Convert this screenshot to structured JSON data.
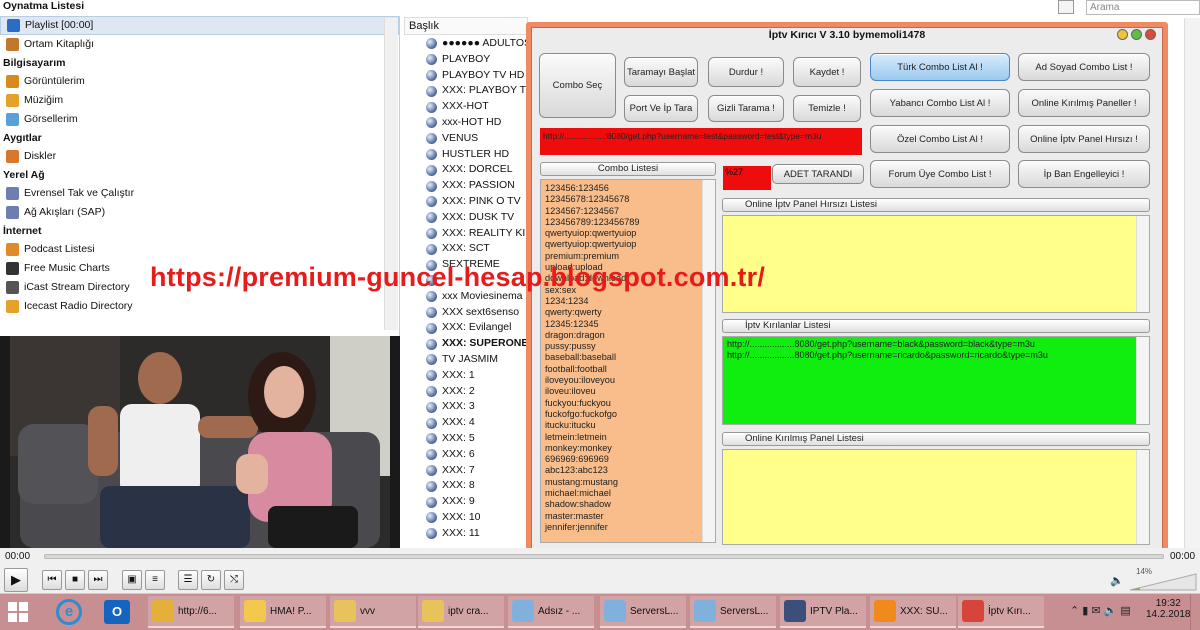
{
  "sidebar": {
    "title": "Oynatma Listesi",
    "items": [
      {
        "type": "item",
        "label": "Playlist [00:00]",
        "icon": "playlist-icon",
        "color": "#2b6cc4",
        "selected": true
      },
      {
        "type": "item",
        "label": "Ortam Kitaplığı",
        "icon": "library-icon",
        "color": "#c2772c"
      },
      {
        "type": "section",
        "label": "Bilgisayarım"
      },
      {
        "type": "item",
        "label": "Görüntülerim",
        "icon": "film-icon",
        "color": "#d88b1d"
      },
      {
        "type": "item",
        "label": "Müziğim",
        "icon": "music-icon",
        "color": "#e6a12b"
      },
      {
        "type": "item",
        "label": "Görsellerim",
        "icon": "pictures-icon",
        "color": "#5aa0d8"
      },
      {
        "type": "section",
        "label": "Aygıtlar"
      },
      {
        "type": "item",
        "label": "Diskler",
        "icon": "disc-icon",
        "color": "#d9772c"
      },
      {
        "type": "section",
        "label": "Yerel Ağ"
      },
      {
        "type": "item",
        "label": "Evrensel Tak ve Çalıştır",
        "icon": "network-icon",
        "color": "#6c7fb0"
      },
      {
        "type": "item",
        "label": "Ağ Akışları (SAP)",
        "icon": "network-icon",
        "color": "#6c7fb0"
      },
      {
        "type": "section",
        "label": "İnternet"
      },
      {
        "type": "item",
        "label": "Podcast Listesi",
        "icon": "podcast-icon",
        "color": "#e08a2a"
      },
      {
        "type": "item",
        "label": "Free Music Charts",
        "icon": "music-charts-icon",
        "color": "#333333"
      },
      {
        "type": "item",
        "label": "iCast Stream Directory",
        "icon": "icast-icon",
        "color": "#555555"
      },
      {
        "type": "item",
        "label": "Icecast Radio Directory",
        "icon": "radio-icon",
        "color": "#e6a12b"
      }
    ]
  },
  "playlist": {
    "header": "Başlık",
    "rows": [
      "●●●●●● ADULTOS",
      "PLAYBOY",
      "PLAYBOY TV HD",
      "XXX: PLAYBOY TV",
      "XXX-HOT",
      "xxx-HOT HD",
      "VENUS",
      "HUSTLER HD",
      "XXX: DORCEL",
      "XXX: PASSION",
      "XXX: PINK O TV",
      "XXX: DUSK TV",
      "XXX: REALITY KIN",
      "XXX: SCT",
      "SEXTREME",
      "",
      "xxx Moviesinema",
      "XXX sext6senso",
      "XXX: Evilangel",
      "XXX: SUPERONE",
      "TV JASMIM",
      "XXX: 1",
      "XXX: 2",
      "XXX: 3",
      "XXX: 4",
      "XXX: 5",
      "XXX: 6",
      "XXX: 7",
      "XXX: 8",
      "XXX: 9",
      "XXX: 10",
      "XXX: 11"
    ],
    "bold_row": "XXX: SUPERONE"
  },
  "search": {
    "placeholder": "Arama"
  },
  "iptv": {
    "title": "İptv Kırıcı V 3.10  bymemoli1478",
    "buttons": {
      "combo_sec": "Combo Seç",
      "taramayi_baslat": "Taramayı Başlat",
      "durdur": "Durdur !",
      "kaydet": "Kaydet !",
      "port_ip_tara": "Port Ve İp Tara",
      "gizli_tarama": "Gizli Tarama !",
      "temizle": "Temizle !",
      "turk_combo": "Türk Combo List Al !",
      "yabanci_combo": "Yabancı  Combo  List Al !",
      "ozel_combo": "Özel Combo List Al !",
      "forum_combo": "Forum Üye Combo List !",
      "ad_soyad_combo": "Ad Soyad Combo List !",
      "online_kirilmis": "Online Kırılmış Paneller !",
      "online_hirsizi": "Online İptv Panel Hırsızı !",
      "ip_ban": "İp Ban Engelleyici !"
    },
    "url_bar": "http://.................:8080/get.php?username=test&password=test&type=m3u",
    "combo_label": "Combo Listesi",
    "progress_value": "%27",
    "adet_label": "ADET TARANDI",
    "panel_hirsizi_label": "Online İptv Panel Hırsızı Listesi",
    "kirilanlar_label": "İptv Kırılanlar Listesi",
    "kirilmis_panel_label": "Online Kırılmış Panel Listesi",
    "kirilanlar": [
      "http://..................8080/get.php?username=black&password=black&type=m3u",
      "http://..................8080/get.php?username=ricardo&password=ricardo&type=m3u"
    ],
    "combo_entries": [
      "123456:123456",
      "12345678:12345678",
      "1234567:1234567",
      "123456789:123456789",
      "qwertyuiop:qwertyuiop",
      "qwertyuiop:qwertyuiop",
      "premium:premium",
      "upload:upload",
      "download:download",
      "sex:sex",
      "1234:1234",
      "qwerty:qwerty",
      "12345:12345",
      "dragon:dragon",
      "pussy:pussy",
      "baseball:baseball",
      "football:football",
      "iloveyou:iloveyou",
      "iloveu:iloveu",
      "fuckyou:fuckyou",
      "fuckofgo:fuckofgo",
      "itucku:itucku",
      "letmein:letmein",
      "monkey:monkey",
      "696969:696969",
      "abc123:abc123",
      "mustang:mustang",
      "michael:michael",
      "shadow:shadow",
      "master:master",
      "jennifer:jennifer"
    ]
  },
  "watermark": "https://premium-guncel-hesap.blogspot.com.tr/",
  "player": {
    "time_left": "00:00",
    "time_right": "00:00",
    "volume": "14%"
  },
  "taskbar": {
    "items": [
      {
        "label": "http://6...",
        "icon": "chrome-icon",
        "color": "#e3b03a"
      },
      {
        "label": "HMA! P...",
        "icon": "hma-icon",
        "color": "#f2c94c"
      },
      {
        "label": "vvv",
        "icon": "folder-icon",
        "color": "#e8c25a"
      },
      {
        "label": "iptv cra...",
        "icon": "folder-icon",
        "color": "#e8c25a"
      },
      {
        "label": "Adsız - ...",
        "icon": "notepad-icon",
        "color": "#7fb1dc"
      },
      {
        "label": "ServersL...",
        "icon": "notepad-icon",
        "color": "#7fb1dc"
      },
      {
        "label": "ServersL...",
        "icon": "notepad-icon",
        "color": "#7fb1dc"
      },
      {
        "label": "IPTV Pla...",
        "icon": "search-app-icon",
        "color": "#3b4f7a"
      },
      {
        "label": "XXX: SU...",
        "icon": "vlc-icon",
        "color": "#f08a1c"
      },
      {
        "label": "İptv Kırı...",
        "icon": "iptv-app-icon",
        "color": "#d7443a"
      }
    ],
    "time": "19:32",
    "date": "14.2.2018"
  }
}
